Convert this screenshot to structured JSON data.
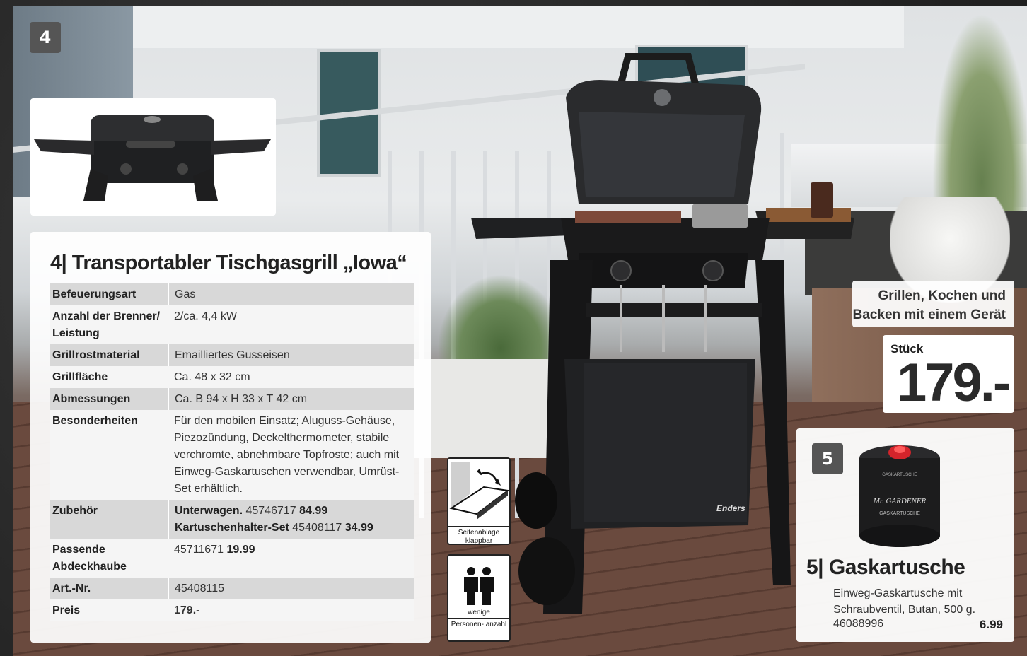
{
  "page_number": "4",
  "main": {
    "title": "4| Transportabler Tischgasgrill „Iowa“",
    "specs": [
      {
        "key": "Befeuerungsart",
        "value": "Gas"
      },
      {
        "key": "Anzahl der Brenner/ Leistung",
        "value": "2/ca. 4,4 kW"
      },
      {
        "key": "Grillrostmaterial",
        "value": "Emailliertes Gusseisen"
      },
      {
        "key": "Grillfläche",
        "value": "Ca. 48 x 32 cm"
      },
      {
        "key": "Abmessungen",
        "value": "Ca. B 94 x H 33 x T 42 cm"
      },
      {
        "key": "Besonderheiten",
        "value": "Für den mobilen Einsatz; Aluguss-Gehäuse, Piezozündung, Deckelthermometer, stabile verchromte, abnehmbare Topfroste; auch mit Einweg-Gaskartuschen verwendbar, Umrüst-Set erhältlich."
      }
    ],
    "accessories": {
      "key": "Zubehör",
      "line1_name": "Unterwagen.",
      "line1_art": "45746717",
      "line1_price": "84.99",
      "line2_name": "Kartuschenhalter-Set",
      "line2_art": "45408117",
      "line2_price": "34.99"
    },
    "cover": {
      "key": "Passende Abdeckhaube",
      "art": "45711671",
      "price": "19.99"
    },
    "artnr": {
      "key": "Art.-Nr.",
      "value": "45408115"
    },
    "preis": {
      "key": "Preis",
      "value": "179.-"
    }
  },
  "pictograms": [
    {
      "icon": "side-shelf-icon",
      "caption": "Seitenablage klappbar"
    },
    {
      "icon": "people-icon",
      "sub": "wenige",
      "caption": "Personen- anzahl"
    }
  ],
  "offer": {
    "slogan_line1": "Grillen, Kochen und",
    "slogan_line2": "Backen mit einem Gerät",
    "unit": "Stück",
    "price": "179.-"
  },
  "item5": {
    "badge": "5",
    "title": "5| Gaskartusche",
    "description": "Einweg-Gaskartusche mit Schraubventil, Butan, 500 g.",
    "art": "46088996",
    "price": "6.99",
    "can_brand": "Mr. GARDENER",
    "can_label": "GASKARTUSCHE"
  },
  "grill_brand": "Enders"
}
